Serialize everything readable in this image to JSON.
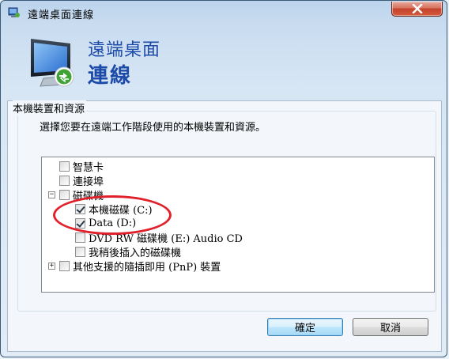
{
  "window": {
    "title": "遠端桌面連線"
  },
  "header": {
    "line1": "遠端桌面",
    "line2": "連線"
  },
  "group": {
    "title": "本機裝置和資源",
    "description": "選擇您要在遠端工作階段使用的本機裝置和資源。"
  },
  "tree": {
    "smart_card": "智慧卡",
    "ports": "連接埠",
    "drives": "磁碟機",
    "drive_c": "本機磁碟 (C:)",
    "drive_d": "Data (D:)",
    "drive_e": "DVD RW 磁碟機 (E:) Audio CD",
    "later_drives": "我稍後插入的磁碟機",
    "pnp": "其他支援的隨插即用 (PnP) 裝置",
    "expanded_symbol": "−",
    "collapsed_symbol": "+"
  },
  "buttons": {
    "ok": "確定",
    "cancel": "取消"
  },
  "colors": {
    "header_text": "#1b4aa8",
    "annotation": "#e0202a",
    "close_button": "#c3422c"
  }
}
